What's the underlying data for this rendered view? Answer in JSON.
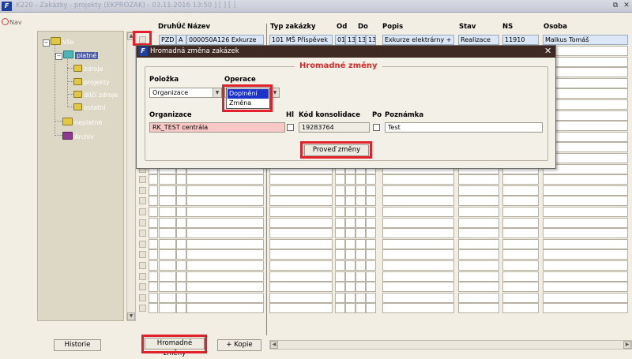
{
  "window": {
    "title": "K220 - Zakázky - projekty (EKPROZAK) - 03.11.2016 13:50 ] [ ] [ ]",
    "app_icon": "F",
    "restore_icon": "⧉",
    "close_icon": "✕"
  },
  "nav": {
    "label": "Nav"
  },
  "tree": {
    "root": "Vše",
    "platne": "platné",
    "zdroje": "zdroje",
    "projekty": "projekty",
    "dilci_zdroje": "dílčí zdroje",
    "ostatni": "ostatní",
    "neplatne": "neplatné",
    "archiv": "Archiv"
  },
  "grid": {
    "columns": {
      "druh": "Druh",
      "uc": "Úč",
      "nazev": "Název",
      "typ": "Typ zakázky",
      "od": "Od",
      "do": "Do",
      "popis": "Popis",
      "stav": "Stav",
      "ns": "NS",
      "osoba": "Osoba"
    },
    "row1": {
      "druh": "PZD",
      "uc": "A",
      "nazev": "000050A126 Exkurze",
      "typ": "101 MŠ Příspěvek",
      "od": "01",
      "od2": "13",
      "do": "13",
      "do2": "13",
      "popis": "Exkurze elektrárny + A",
      "stav": "Realizace",
      "ns": "11910",
      "osoba": "Malkus Tomáš"
    }
  },
  "dialog": {
    "title": "Hromadná změna zakázek",
    "group_title": "Hromadné změny",
    "polozka_label": "Položka",
    "polozka_value": "Organizace",
    "operace_label": "Operace",
    "operace_options": [
      "Doplnění",
      "Změna"
    ],
    "organizace_label": "Organizace",
    "organizace_value": "RK_TEST centrála",
    "hl_label": "Hl",
    "kod_label": "Kód konsolidace",
    "kod_value": "19283764",
    "po_label": "Po",
    "poznamka_label": "Poznámka",
    "poznamka_value": "Test",
    "execute_button": "Proveď změny",
    "close_icon": "✕"
  },
  "bottom": {
    "historie": "Historie",
    "hromadne": "Hromadné změny",
    "kopie": "+ Kopie"
  },
  "colors": {
    "highlight_red": "#e0202a",
    "dialog_title_bg": "#3e2a22",
    "selected_row": "#dbe7f6",
    "org_field_bg": "#f7c8c6",
    "dropdown_selected": "#1c33c9"
  }
}
